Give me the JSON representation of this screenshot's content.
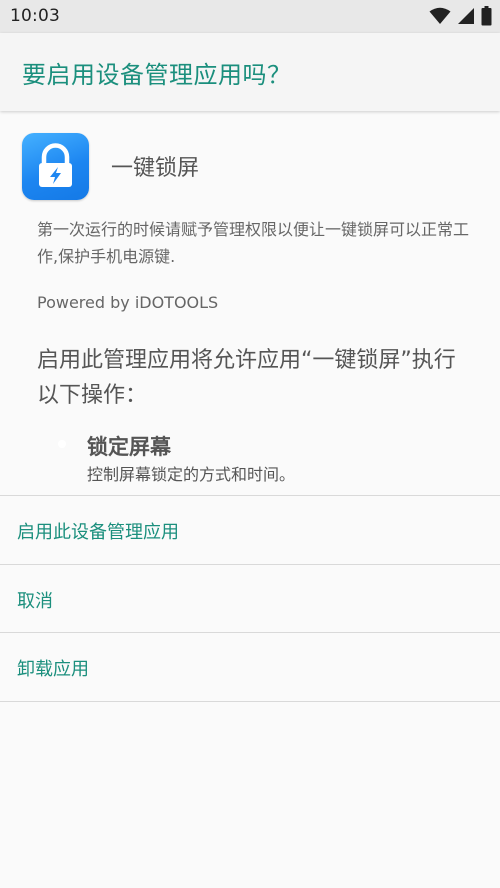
{
  "status_bar": {
    "time": "10:03",
    "icons": [
      "wifi-icon",
      "cell-signal-icon",
      "battery-icon"
    ]
  },
  "app_bar": {
    "title": "要启用设备管理应用吗？"
  },
  "app": {
    "icon": "lock-icon",
    "name": "一键锁屏",
    "description": "第一次运行的时候请赋予管理权限以便让一键锁屏可以正常工作,保护手机电源键.",
    "powered_by": "Powered by iDOTOOLS"
  },
  "warning": "启用此管理应用将允许应用“一键锁屏”执行以下操作：",
  "policy": {
    "title": "锁定屏幕",
    "description": "控制屏幕锁定的方式和时间。"
  },
  "actions": {
    "activate": "启用此设备管理应用",
    "cancel": "取消",
    "uninstall": "卸载应用"
  },
  "colors": {
    "accent": "#1b8f7d",
    "icon_blue": "#1d86f1",
    "background": "#fafafa",
    "status_bar": "#e8e8e8"
  }
}
